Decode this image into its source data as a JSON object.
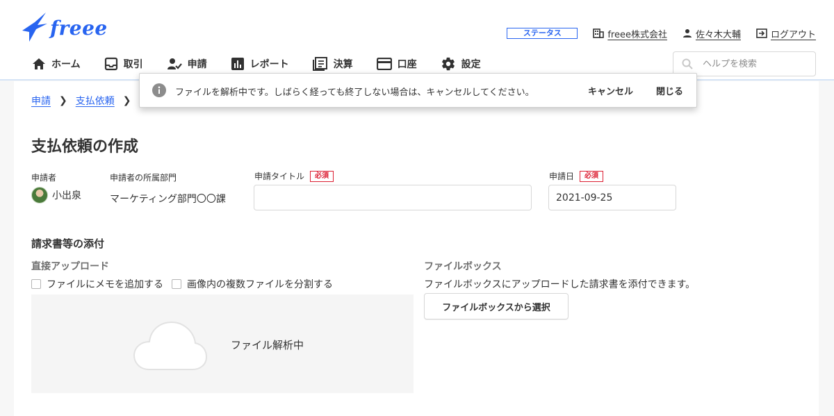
{
  "brand": {
    "name": "freee",
    "accent": "#2864f0"
  },
  "topbar": {
    "status_label": "ステータス",
    "company": "freee株式会社",
    "user": "佐々木大輔",
    "logout": "ログアウト",
    "icons": [
      "building-icon",
      "person-icon",
      "logout-icon"
    ]
  },
  "nav": {
    "items": [
      {
        "label": "ホーム",
        "icon": "home-icon"
      },
      {
        "label": "取引",
        "icon": "inbox-icon"
      },
      {
        "label": "申請",
        "icon": "user-check-icon"
      },
      {
        "label": "レポート",
        "icon": "bar-chart-icon"
      },
      {
        "label": "決算",
        "icon": "book-icon"
      },
      {
        "label": "口座",
        "icon": "card-icon"
      },
      {
        "label": "設定",
        "icon": "gear-icon"
      }
    ],
    "help_placeholder": "ヘルプを検索"
  },
  "toast": {
    "message": "ファイルを解析中です。しばらく経っても終了しない場合は、キャンセルしてください。",
    "cancel": "キャンセル",
    "close": "閉じる"
  },
  "breadcrumb": {
    "items": [
      "申請",
      "支払依頼"
    ]
  },
  "page": {
    "title": "支払依頼の作成"
  },
  "form": {
    "applicant_label": "申請者",
    "applicant_name": "小出泉",
    "dept_label": "申請者の所属部門",
    "dept_value": "マーケティング部門〇〇課",
    "title_label": "申請タイトル",
    "title_value": "",
    "date_label": "申請日",
    "date_value": "2021-09-25",
    "required": "必須"
  },
  "attach": {
    "section_title": "請求書等の添付",
    "direct_title": "直接アップロード",
    "memo_option": "ファイルにメモを追加する",
    "split_option": "画像内の複数ファイルを分割する",
    "dropzone_status": "ファイル解析中",
    "filebox_title": "ファイルボックス",
    "filebox_desc": "ファイルボックスにアップロードした請求書を添付できます。",
    "filebox_button": "ファイルボックスから選択"
  }
}
